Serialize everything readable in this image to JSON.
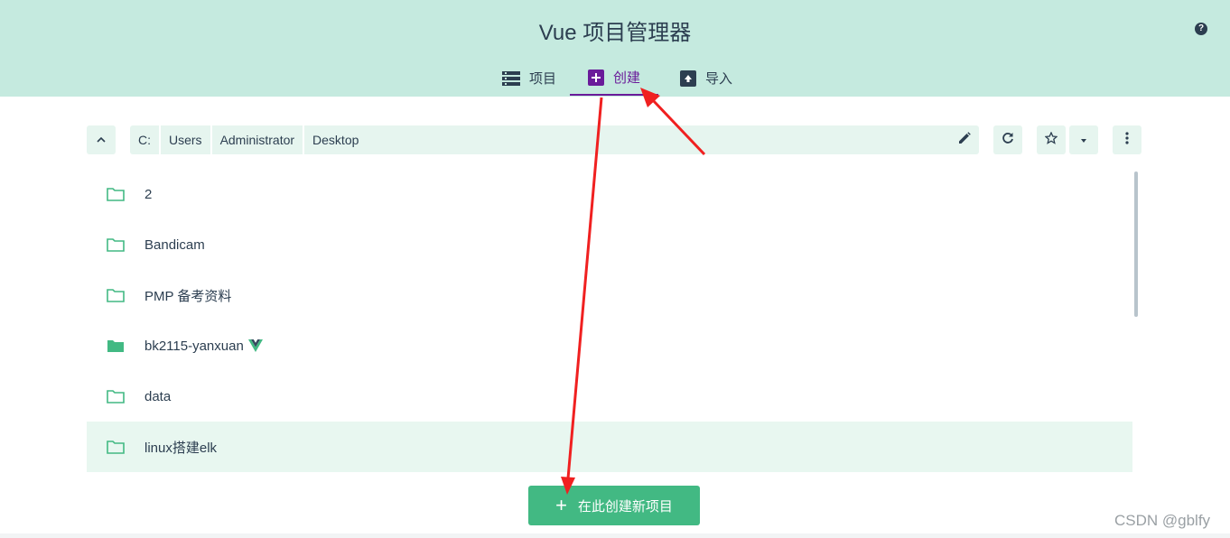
{
  "header": {
    "title": "Vue 项目管理器",
    "help_icon": "?",
    "tabs": [
      {
        "label": "项目",
        "icon": "list-icon"
      },
      {
        "label": "创建",
        "icon": "plus-square-icon",
        "active": true
      },
      {
        "label": "导入",
        "icon": "import-icon"
      }
    ]
  },
  "toolbar": {
    "up_icon": "chevron-up-icon",
    "path": [
      "C:",
      "Users",
      "Administrator",
      "Desktop"
    ],
    "edit_icon": "pencil-icon",
    "refresh_icon": "refresh-icon",
    "favorite_icon": "star-icon",
    "favorites_dropdown_icon": "caret-down-icon",
    "more_icon": "more-vert-icon"
  },
  "folders": [
    {
      "name": "2",
      "type": "folder-outline"
    },
    {
      "name": "Bandicam",
      "type": "folder-outline"
    },
    {
      "name": "PMP 备考资料",
      "type": "folder-outline"
    },
    {
      "name": "bk2115-yanxuan",
      "type": "folder-filled",
      "vue_project": true
    },
    {
      "name": "data",
      "type": "folder-outline"
    },
    {
      "name": "linux搭建elk",
      "type": "folder-outline",
      "selected": true
    }
  ],
  "create_button": {
    "label": "在此创建新项目"
  },
  "watermark": "CSDN @gblfy",
  "colors": {
    "accent": "#42b983",
    "header_bg": "#c5eadf",
    "active_tab": "#6a1b9a",
    "annotation_arrow": "#f02020"
  }
}
